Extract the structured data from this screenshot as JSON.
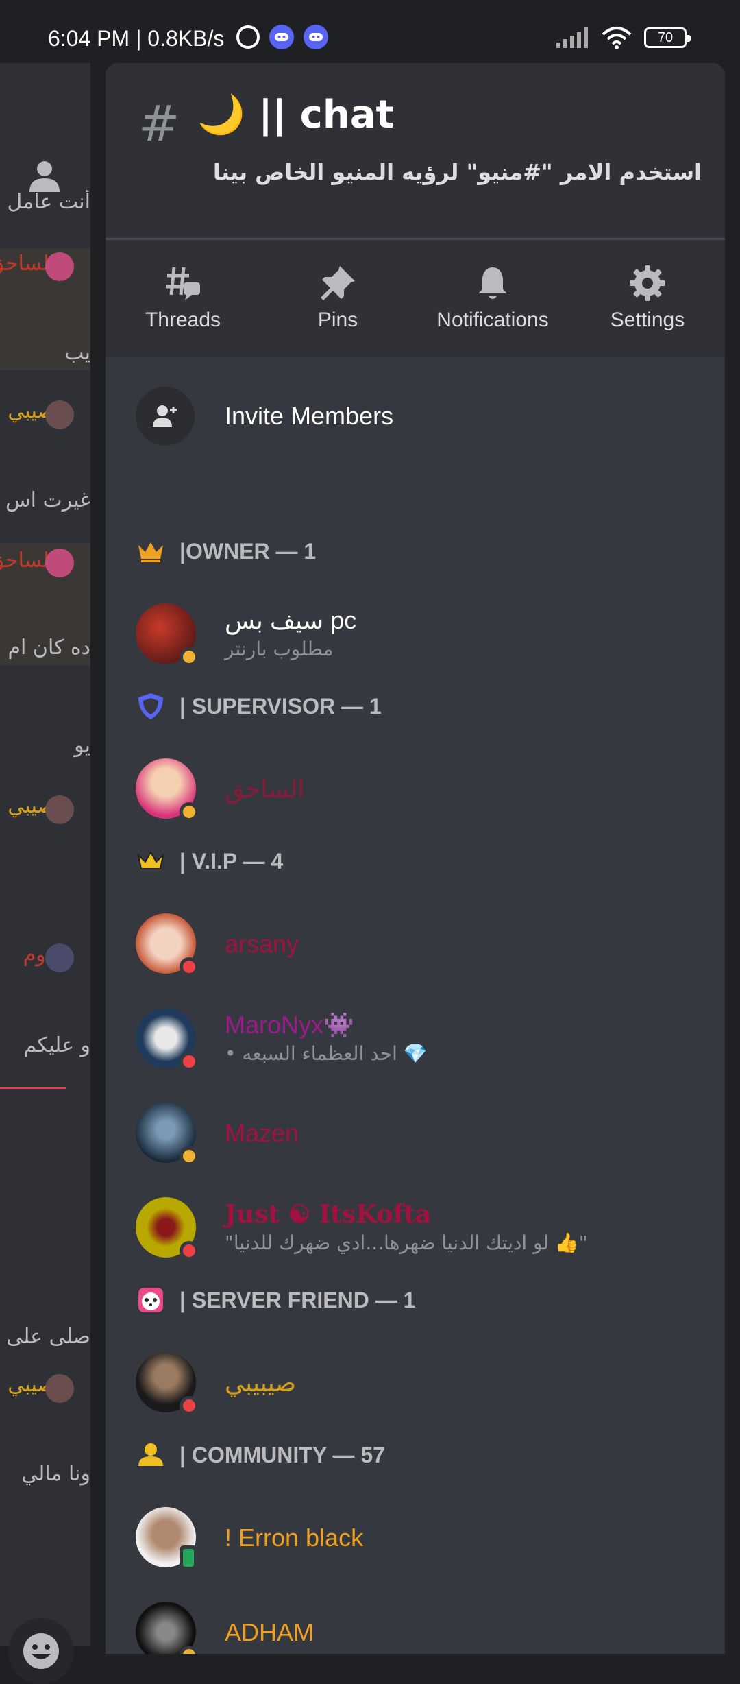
{
  "status_bar": {
    "time": "6:04 PM | 0.8KB/s",
    "battery": "70"
  },
  "background_chat": {
    "rows": [
      "أنت عامل",
      "الساحق",
      "يب",
      "صيبي",
      "غيرت اس",
      "الساحق",
      "ده كان ام",
      "يو",
      "صيبي",
      "دوم",
      "و عليكم",
      "صلى على",
      "صيبي",
      "ونا مالي"
    ]
  },
  "channel": {
    "name": "🌙 || chat",
    "topic": "استخدم الامر \"#منيو\" لرؤيه المنيو الخاص بينا"
  },
  "actions": [
    {
      "label": "Threads",
      "icon": "threads-icon"
    },
    {
      "label": "Pins",
      "icon": "pin-icon"
    },
    {
      "label": "Notifications",
      "icon": "bell-icon"
    },
    {
      "label": "Settings",
      "icon": "gear-icon"
    }
  ],
  "invite": {
    "label": "Invite Members"
  },
  "sections": [
    {
      "label": "|OWNER — 1",
      "icon": "crown-icon"
    },
    {
      "label": "| SUPERVISOR — 1",
      "icon": "shield-icon"
    },
    {
      "label": "| V.I.P — 4",
      "icon": "crown-outline-icon"
    },
    {
      "label": "| SERVER FRIEND — 1",
      "icon": "panda-icon"
    },
    {
      "label": "| COMMUNITY — 57",
      "icon": "person-icon"
    }
  ],
  "members": [
    {
      "name": "سيف بس pc",
      "sub": "مطلوب بارنتر",
      "color": "#ffffff",
      "status": "idle"
    },
    {
      "name": "الساحق",
      "sub": "",
      "color": "#8b1a3a",
      "status": "idle"
    },
    {
      "name": "arsany",
      "sub": "",
      "color": "#a3123f",
      "status": "dnd"
    },
    {
      "name": "MaroNyx👾",
      "sub": "• احد العظماء السبعه 💎",
      "color": "#9a1c8c",
      "status": "dnd"
    },
    {
      "name": "Mazen",
      "sub": "",
      "color": "#a3123f",
      "status": "idle"
    },
    {
      "name": "Just ☯ ItsKofta",
      "sub": "\"لو اديتك الدنيا ضهرها...ادي ضهرك للدنيا 👍\"",
      "color": "#a3123f",
      "status": "dnd"
    },
    {
      "name": "صيبيبي",
      "sub": "",
      "color": "#d4a017",
      "status": "dnd"
    },
    {
      "name": "! Erron black",
      "sub": "",
      "color": "#f0a020",
      "status": "mobile"
    },
    {
      "name": "ADHAM",
      "sub": "",
      "color": "#f0a020",
      "status": "idle"
    }
  ],
  "colors": {
    "idle": "#f0b232",
    "dnd": "#ed4245",
    "online": "#23a55a"
  }
}
